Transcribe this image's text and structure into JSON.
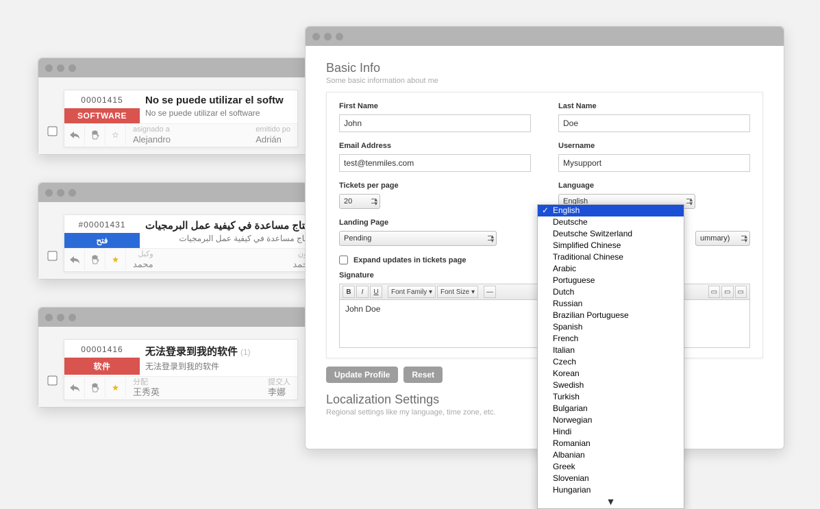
{
  "tickets": [
    {
      "id": "00001415",
      "tag": "SOFTWARE",
      "tag_color": "red",
      "title": "No se puede utilizar el softw",
      "subtitle": "No se puede utilizar el software",
      "assigned_label": "asignado a",
      "assigned_to": "Alejandro",
      "issued_label": "emitido po",
      "issued_by": "Adrián",
      "starred": false,
      "rtl": false,
      "count": null
    },
    {
      "id": "#00001431",
      "tag": "فتح",
      "tag_color": "blue",
      "title": "تحتاج مساعدة في كيفية عمل البرمجيات",
      "subtitle": "تحتاج مساعدة في كيفية عمل البرمجيات",
      "assigned_label": "وكيل",
      "assigned_to": "محمد",
      "issued_label": "زبون",
      "issued_by": "محمد",
      "starred": true,
      "rtl": true,
      "count": null
    },
    {
      "id": "00001416",
      "tag": "软件",
      "tag_color": "red",
      "title": "无法登录到我的软件",
      "subtitle": "无法登录到我的软件",
      "assigned_label": "分配",
      "assigned_to": "王秀英",
      "issued_label": "提交人",
      "issued_by": "李娜",
      "starred": true,
      "rtl": false,
      "count": "(1)"
    }
  ],
  "profile": {
    "section_title": "Basic Info",
    "section_sub": "Some basic information about me",
    "first_name_label": "First Name",
    "first_name": "John",
    "last_name_label": "Last Name",
    "last_name": "Doe",
    "email_label": "Email Address",
    "email": "test@tenmiles.com",
    "username_label": "Username",
    "username": "Mysupport",
    "tpp_label": "Tickets per page",
    "tpp_value": "20",
    "language_label": "Language",
    "language_value": "English",
    "landing_label": "Landing Page",
    "landing_value": "Pending",
    "summary_value": "ummary)",
    "expand_label": "Expand updates in tickets page",
    "signature_label": "Signature",
    "sig_fontfamily": "Font Family",
    "sig_fontsize": "Font Size",
    "signature_text": "John Doe",
    "update_btn": "Update Profile",
    "reset_btn": "Reset",
    "loc_title": "Localization Settings",
    "loc_sub": "Regional settings like my language, time zone, etc."
  },
  "languages": [
    "English",
    "Deutsche",
    "Deutsche Switzerland",
    "Simplified Chinese",
    "Traditional Chinese",
    "Arabic",
    "Portuguese",
    "Dutch",
    "Russian",
    "Brazilian Portuguese",
    "Spanish",
    "French",
    "Italian",
    "Czech",
    "Korean",
    "Swedish",
    "Turkish",
    "Bulgarian",
    "Norwegian",
    "Hindi",
    "Romanian",
    "Albanian",
    "Greek",
    "Slovenian",
    "Hungarian"
  ]
}
